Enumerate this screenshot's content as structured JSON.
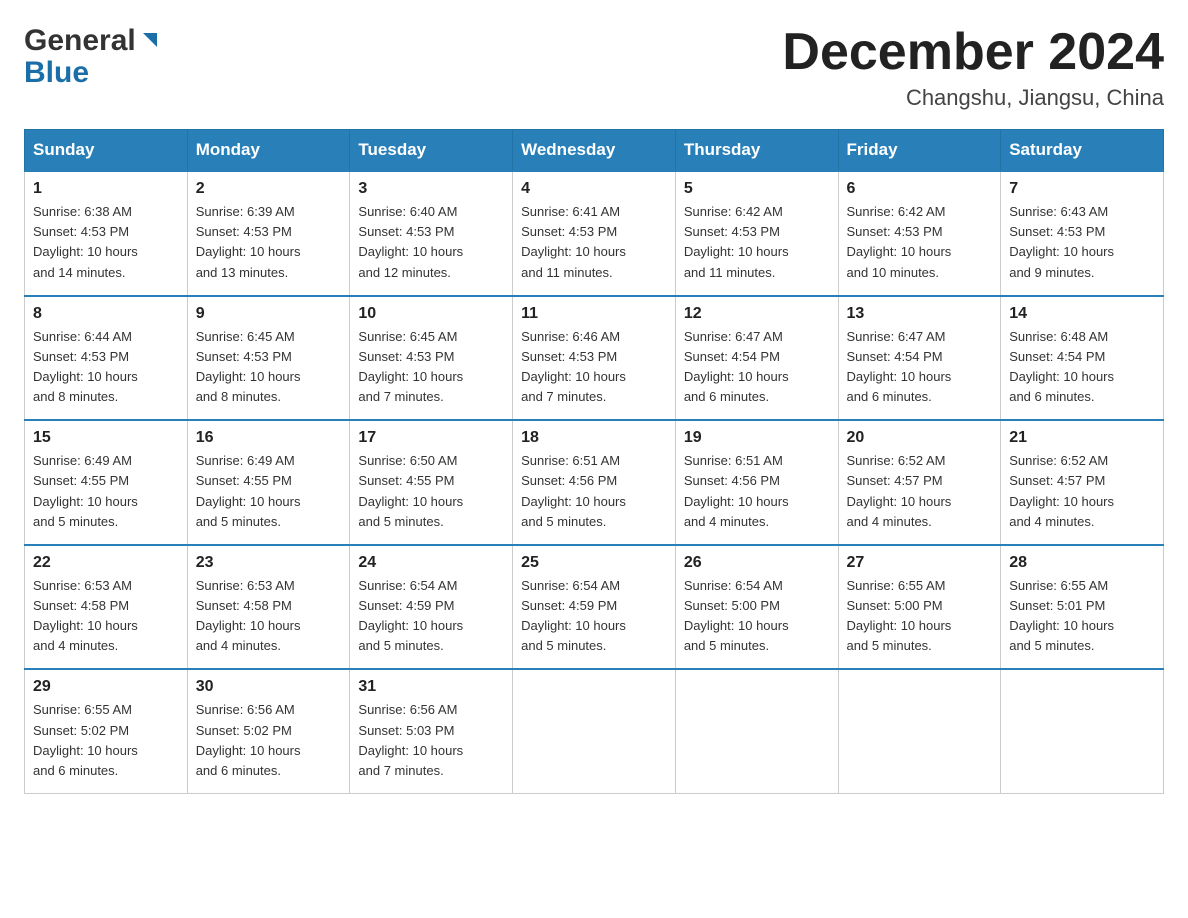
{
  "header": {
    "logo_general": "General",
    "logo_blue": "Blue",
    "month_title": "December 2024",
    "location": "Changshu, Jiangsu, China"
  },
  "weekdays": [
    "Sunday",
    "Monday",
    "Tuesday",
    "Wednesday",
    "Thursday",
    "Friday",
    "Saturday"
  ],
  "weeks": [
    [
      {
        "day": "1",
        "sunrise": "6:38 AM",
        "sunset": "4:53 PM",
        "daylight": "10 hours and 14 minutes."
      },
      {
        "day": "2",
        "sunrise": "6:39 AM",
        "sunset": "4:53 PM",
        "daylight": "10 hours and 13 minutes."
      },
      {
        "day": "3",
        "sunrise": "6:40 AM",
        "sunset": "4:53 PM",
        "daylight": "10 hours and 12 minutes."
      },
      {
        "day": "4",
        "sunrise": "6:41 AM",
        "sunset": "4:53 PM",
        "daylight": "10 hours and 11 minutes."
      },
      {
        "day": "5",
        "sunrise": "6:42 AM",
        "sunset": "4:53 PM",
        "daylight": "10 hours and 11 minutes."
      },
      {
        "day": "6",
        "sunrise": "6:42 AM",
        "sunset": "4:53 PM",
        "daylight": "10 hours and 10 minutes."
      },
      {
        "day": "7",
        "sunrise": "6:43 AM",
        "sunset": "4:53 PM",
        "daylight": "10 hours and 9 minutes."
      }
    ],
    [
      {
        "day": "8",
        "sunrise": "6:44 AM",
        "sunset": "4:53 PM",
        "daylight": "10 hours and 8 minutes."
      },
      {
        "day": "9",
        "sunrise": "6:45 AM",
        "sunset": "4:53 PM",
        "daylight": "10 hours and 8 minutes."
      },
      {
        "day": "10",
        "sunrise": "6:45 AM",
        "sunset": "4:53 PM",
        "daylight": "10 hours and 7 minutes."
      },
      {
        "day": "11",
        "sunrise": "6:46 AM",
        "sunset": "4:53 PM",
        "daylight": "10 hours and 7 minutes."
      },
      {
        "day": "12",
        "sunrise": "6:47 AM",
        "sunset": "4:54 PM",
        "daylight": "10 hours and 6 minutes."
      },
      {
        "day": "13",
        "sunrise": "6:47 AM",
        "sunset": "4:54 PM",
        "daylight": "10 hours and 6 minutes."
      },
      {
        "day": "14",
        "sunrise": "6:48 AM",
        "sunset": "4:54 PM",
        "daylight": "10 hours and 6 minutes."
      }
    ],
    [
      {
        "day": "15",
        "sunrise": "6:49 AM",
        "sunset": "4:55 PM",
        "daylight": "10 hours and 5 minutes."
      },
      {
        "day": "16",
        "sunrise": "6:49 AM",
        "sunset": "4:55 PM",
        "daylight": "10 hours and 5 minutes."
      },
      {
        "day": "17",
        "sunrise": "6:50 AM",
        "sunset": "4:55 PM",
        "daylight": "10 hours and 5 minutes."
      },
      {
        "day": "18",
        "sunrise": "6:51 AM",
        "sunset": "4:56 PM",
        "daylight": "10 hours and 5 minutes."
      },
      {
        "day": "19",
        "sunrise": "6:51 AM",
        "sunset": "4:56 PM",
        "daylight": "10 hours and 4 minutes."
      },
      {
        "day": "20",
        "sunrise": "6:52 AM",
        "sunset": "4:57 PM",
        "daylight": "10 hours and 4 minutes."
      },
      {
        "day": "21",
        "sunrise": "6:52 AM",
        "sunset": "4:57 PM",
        "daylight": "10 hours and 4 minutes."
      }
    ],
    [
      {
        "day": "22",
        "sunrise": "6:53 AM",
        "sunset": "4:58 PM",
        "daylight": "10 hours and 4 minutes."
      },
      {
        "day": "23",
        "sunrise": "6:53 AM",
        "sunset": "4:58 PM",
        "daylight": "10 hours and 4 minutes."
      },
      {
        "day": "24",
        "sunrise": "6:54 AM",
        "sunset": "4:59 PM",
        "daylight": "10 hours and 5 minutes."
      },
      {
        "day": "25",
        "sunrise": "6:54 AM",
        "sunset": "4:59 PM",
        "daylight": "10 hours and 5 minutes."
      },
      {
        "day": "26",
        "sunrise": "6:54 AM",
        "sunset": "5:00 PM",
        "daylight": "10 hours and 5 minutes."
      },
      {
        "day": "27",
        "sunrise": "6:55 AM",
        "sunset": "5:00 PM",
        "daylight": "10 hours and 5 minutes."
      },
      {
        "day": "28",
        "sunrise": "6:55 AM",
        "sunset": "5:01 PM",
        "daylight": "10 hours and 5 minutes."
      }
    ],
    [
      {
        "day": "29",
        "sunrise": "6:55 AM",
        "sunset": "5:02 PM",
        "daylight": "10 hours and 6 minutes."
      },
      {
        "day": "30",
        "sunrise": "6:56 AM",
        "sunset": "5:02 PM",
        "daylight": "10 hours and 6 minutes."
      },
      {
        "day": "31",
        "sunrise": "6:56 AM",
        "sunset": "5:03 PM",
        "daylight": "10 hours and 7 minutes."
      },
      null,
      null,
      null,
      null
    ]
  ],
  "labels": {
    "sunrise": "Sunrise:",
    "sunset": "Sunset:",
    "daylight": "Daylight:"
  }
}
